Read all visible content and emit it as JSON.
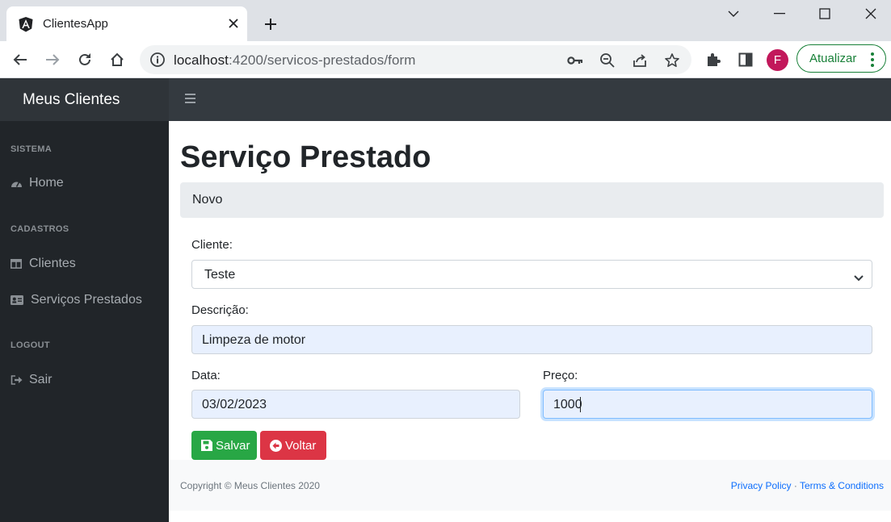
{
  "browser": {
    "tab_title": "ClientesApp",
    "url_host": "localhost",
    "url_rest": ":4200/servicos-prestados/form",
    "update_label": "Atualizar",
    "avatar_letter": "F"
  },
  "app": {
    "brand": "Meus Clientes",
    "sidebar": {
      "sections": [
        {
          "heading": "SISTEMA",
          "items": [
            {
              "label": "Home",
              "icon": "dashboard-icon"
            }
          ]
        },
        {
          "heading": "CADASTROS",
          "items": [
            {
              "label": "Clientes",
              "icon": "table-icon"
            },
            {
              "label": "Serviços Prestados",
              "icon": "id-card-icon"
            }
          ]
        },
        {
          "heading": "LOGOUT",
          "items": [
            {
              "label": "Sair",
              "icon": "sign-out-icon"
            }
          ]
        }
      ]
    }
  },
  "page": {
    "title": "Serviço Prestado",
    "breadcrumb": "Novo"
  },
  "form": {
    "cliente_label": "Cliente:",
    "cliente_value": "Teste",
    "descricao_label": "Descrição:",
    "descricao_value": "Limpeza de motor",
    "data_label": "Data:",
    "data_value": "03/02/2023",
    "preco_label": "Preço:",
    "preco_value": "1000",
    "save_label": "Salvar",
    "back_label": "Voltar"
  },
  "footer": {
    "copyright": "Copyright © Meus Clientes 2020",
    "privacy": "Privacy Policy",
    "separator": "·",
    "terms": "Terms & Conditions"
  },
  "colors": {
    "topbar": "#343a40",
    "sidebar": "#212529",
    "save": "#28a745",
    "back": "#dc3545",
    "update": "#188038"
  }
}
